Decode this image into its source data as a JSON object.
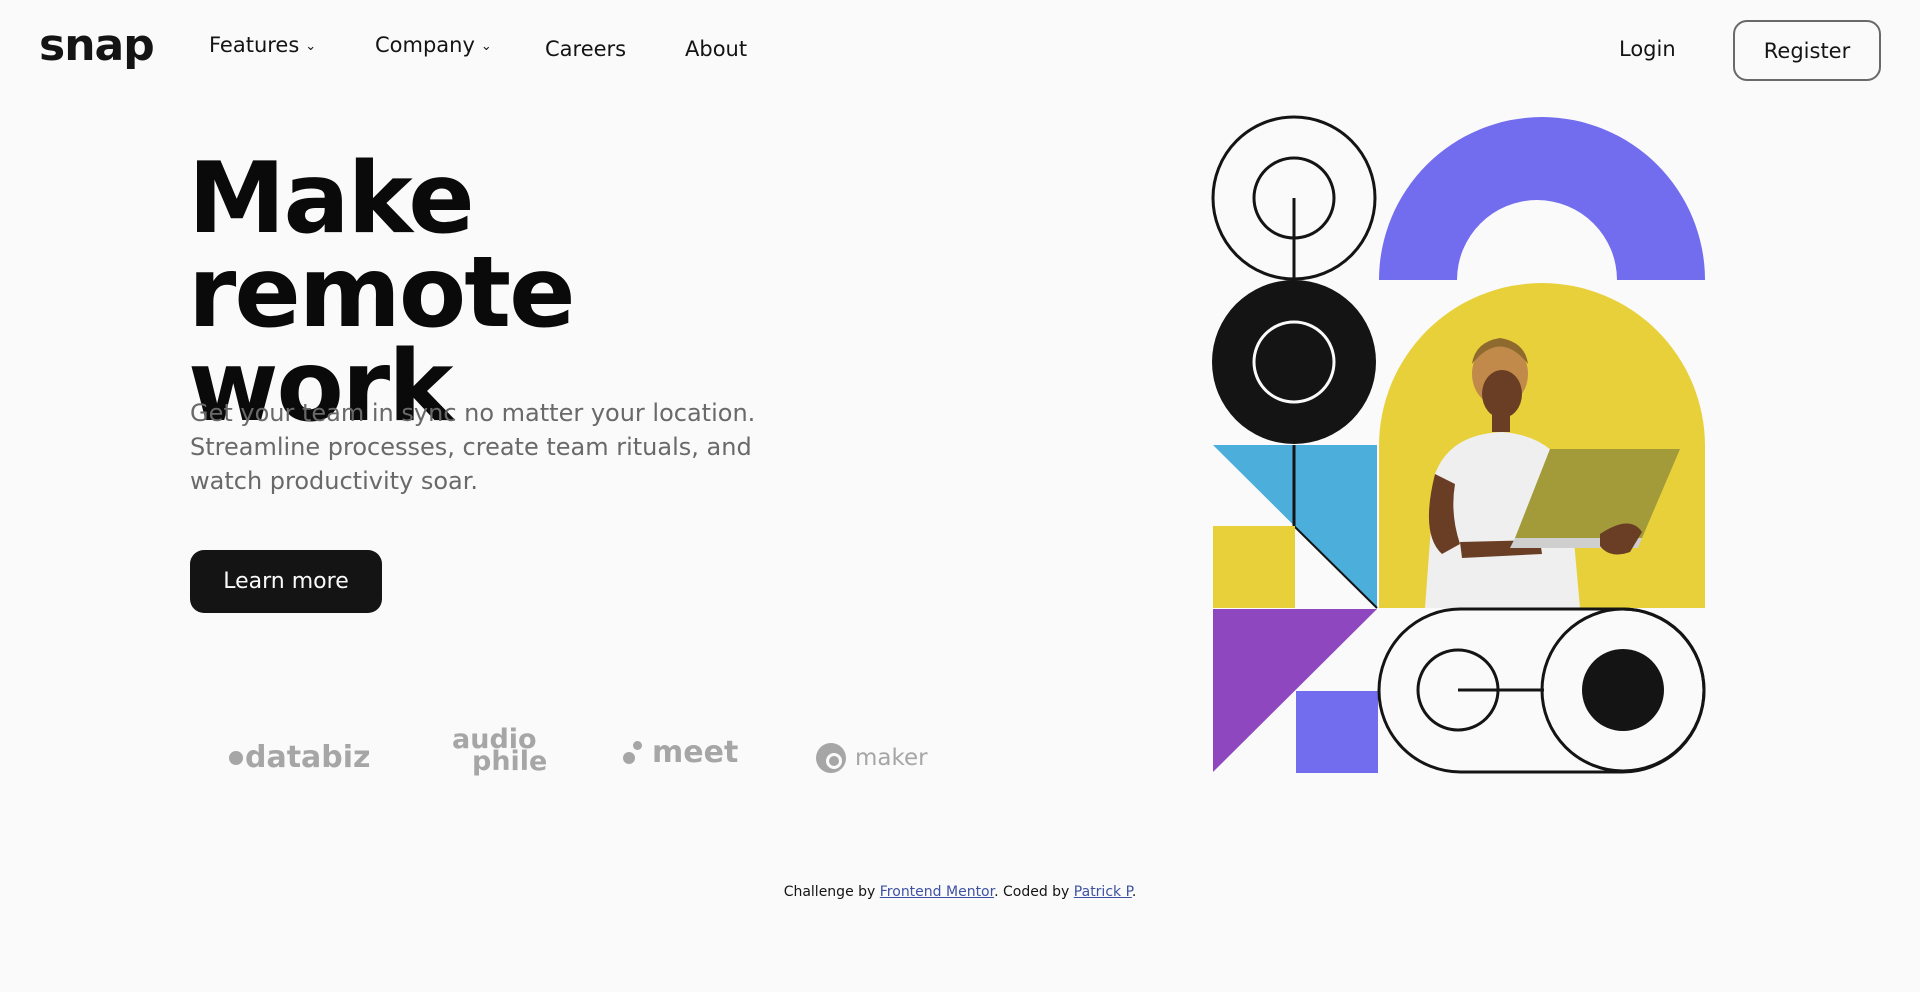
{
  "brand": {
    "logo": "snap"
  },
  "nav": {
    "features": "Features",
    "company": "Company",
    "careers": "Careers",
    "about": "About",
    "login": "Login",
    "register": "Register"
  },
  "hero": {
    "title_line1": "Make remote",
    "title_line2": "work",
    "subtitle": "Get your team in sync no matter your location. Streamline processes, create team rituals, and watch productivity soar.",
    "cta": "Learn more"
  },
  "clients": [
    {
      "name": "databiz"
    },
    {
      "name": "audio",
      "name2": "phile"
    },
    {
      "name": "meet"
    },
    {
      "name": "maker"
    }
  ],
  "footer": {
    "prefix": "Challenge by ",
    "link1": "Frontend Mentor",
    "middle": ". Coded by ",
    "link2": "Patrick P",
    "suffix": "."
  },
  "colors": {
    "ink": "#141414",
    "violet": "#726cee",
    "yellow": "#e8d03b",
    "sky": "#4baedb",
    "purple": "#8e47bf",
    "muted": "#696969"
  }
}
